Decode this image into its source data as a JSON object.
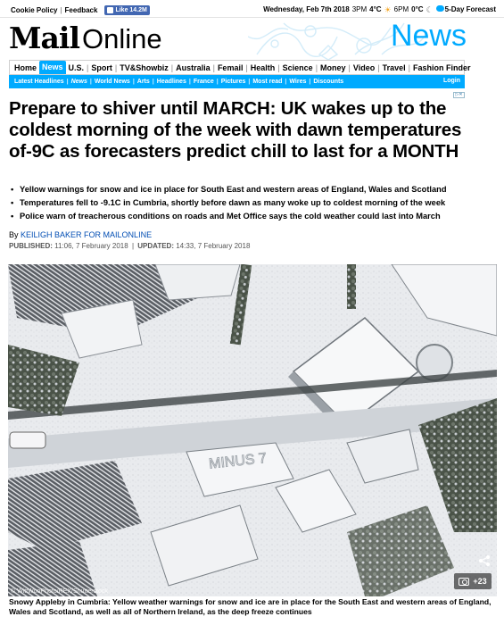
{
  "topbar": {
    "cookie_policy": "Cookie Policy",
    "feedback": "Feedback",
    "fb_like": "Like 14.2M",
    "date": "Wednesday, Feb 7th 2018",
    "time_am": "3PM",
    "temp_am": "4°C",
    "time_pm": "6PM",
    "temp_pm": "0°C",
    "forecast": "5-Day Forecast"
  },
  "masthead": {
    "logo_mail": "Mail",
    "logo_online": "Online",
    "section": "News"
  },
  "nav": {
    "items": [
      "Home",
      "News",
      "U.S.",
      "Sport",
      "TV&Showbiz",
      "Australia",
      "Femail",
      "Health",
      "Science",
      "Money",
      "Video",
      "Travel",
      "Fashion Finder"
    ],
    "active": "News"
  },
  "subnav": {
    "items": [
      "Latest Headlines",
      "News",
      "World News",
      "Arts",
      "Headlines",
      "France",
      "Pictures",
      "Most read",
      "Wires",
      "Discounts"
    ],
    "current": "News",
    "login": "Login"
  },
  "adchoices": "▷✕",
  "article": {
    "headline": "Prepare to shiver until MARCH: UK wakes up to the coldest morning of the week with dawn temperatures of-9C as forecasters predict chill to last for a MONTH",
    "bullets": [
      "Yellow warnings for snow and ice in place for South East and western areas of England, Wales and Scotland",
      "Temperatures fell to -9.1C in Cumbria, shortly before dawn as many woke up to coldest morning of the week",
      "Police warn of treacherous conditions on roads and Met Office says the cold weather could last into March"
    ],
    "by_prefix": "By",
    "author": "KEILIGH BAKER FOR MAILONLINE",
    "published_label": "PUBLISHED:",
    "published": "11:06, 7 February 2018",
    "updated_label": "UPDATED:",
    "updated": "14:33, 7 February 2018",
    "divider": "|",
    "photo_credit": "© WittWooPhoto/REX/Shutterstock",
    "snow_writing": "MINUS 7",
    "gallery_count": "+23",
    "caption": "Snowy Appleby in Cumbria: Yellow weather warnings for snow and ice are in place for the South East and western areas of England, Wales and Scotland, as well as all of Northern Ireland, as the deep freeze continues"
  },
  "colors": {
    "brand_blue": "#00aaff",
    "author_blue": "#004db3",
    "fb_blue": "#4267b2"
  }
}
